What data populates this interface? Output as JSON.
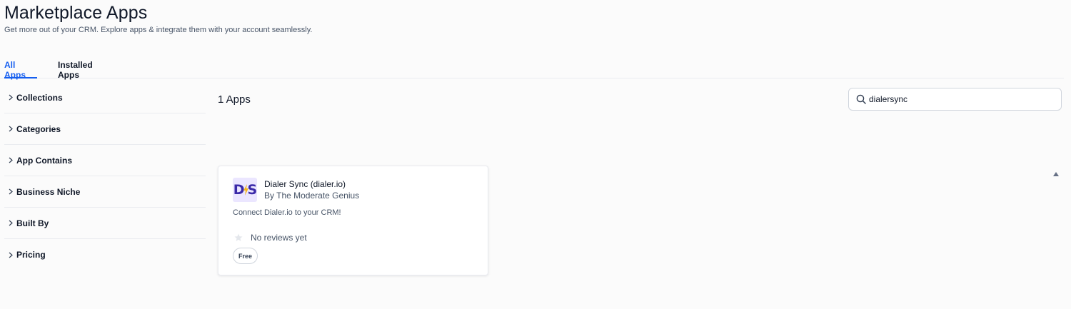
{
  "header": {
    "title": "Marketplace Apps",
    "subtitle": "Get more out of your CRM. Explore apps & integrate them with your account seamlessly."
  },
  "tabs": [
    {
      "label": "All Apps",
      "active": true
    },
    {
      "label": "Installed Apps",
      "active": false
    }
  ],
  "filters": [
    {
      "label": "Collections"
    },
    {
      "label": "Categories"
    },
    {
      "label": "App Contains"
    },
    {
      "label": "Business Niche"
    },
    {
      "label": "Built By"
    },
    {
      "label": "Pricing"
    }
  ],
  "results": {
    "count_label": "1 Apps"
  },
  "search": {
    "value": "dialersync"
  },
  "apps": [
    {
      "name": "Dialer Sync (dialer.io)",
      "author": "By The Moderate Genius",
      "description": "Connect Dialer.io to your CRM!",
      "reviews": "No reviews yet",
      "price": "Free",
      "logo_left": "D",
      "logo_right": "S"
    }
  ],
  "colors": {
    "accent": "#155eef",
    "text": "#101828",
    "muted": "#475467",
    "border": "#eaecf0",
    "logo_bg": "#ebe6ff",
    "logo_text": "#3b2aa8",
    "logo_bolt": "#f5b61a"
  },
  "icons": {
    "search": "search-icon",
    "chevron": "chevron-right-icon",
    "star": "star-icon",
    "scroll": "caret-up-icon"
  }
}
